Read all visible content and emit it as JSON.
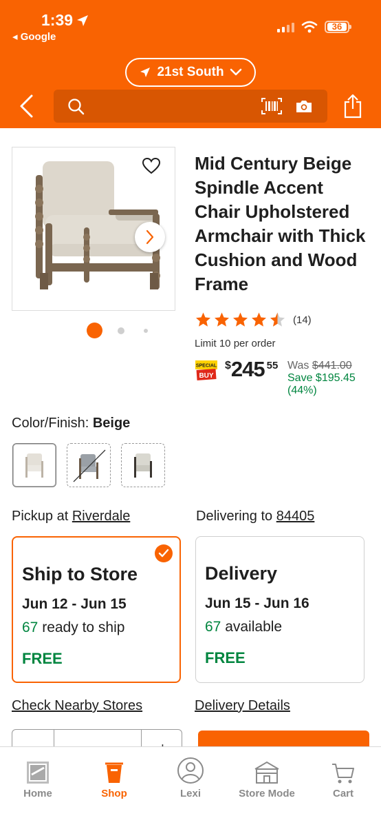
{
  "status_bar": {
    "time": "1:39",
    "back_app": "◂ Google",
    "battery": "36"
  },
  "header": {
    "store_name": "21st South",
    "search_placeholder": ""
  },
  "product": {
    "title": "Mid Century Beige Spindle Accent Chair Upholstered Armchair with Thick Cushion and Wood Frame",
    "rating_value": 4.5,
    "review_count": "(14)",
    "limit_text": "Limit 10 per order",
    "badge_top": "SPECIAL",
    "badge_bottom": "BUY",
    "price_currency": "$",
    "price_dollars": "245",
    "price_cents": "55",
    "was_label": "Was",
    "was_price": "$441.00",
    "save_text": "Save $195.45",
    "save_percent": "(44%)",
    "image_count": 3,
    "active_image": 1
  },
  "color": {
    "label": "Color/Finish:",
    "selected": "Beige",
    "swatches": [
      "beige",
      "grey-unavailable",
      "grey"
    ]
  },
  "fulfillment": {
    "pickup_prefix": "Pickup at",
    "pickup_store": "Riverdale",
    "delivery_prefix": "Delivering to",
    "delivery_zip": "84405",
    "ship_to_store": {
      "title": "Ship to Store",
      "dates": "Jun 12 - Jun 15",
      "count": "67",
      "status": "ready to ship",
      "price": "FREE"
    },
    "delivery": {
      "title": "Delivery",
      "dates": "Jun 15 - Jun 16",
      "count": "67",
      "status": "available",
      "price": "FREE"
    },
    "nearby_link": "Check Nearby Stores",
    "details_link": "Delivery Details"
  },
  "colors": {
    "brand_orange": "#f96302",
    "green": "#00853f"
  },
  "tabbar": {
    "home": "Home",
    "shop": "Shop",
    "lexi": "Lexi",
    "store_mode": "Store Mode",
    "cart": "Cart"
  }
}
